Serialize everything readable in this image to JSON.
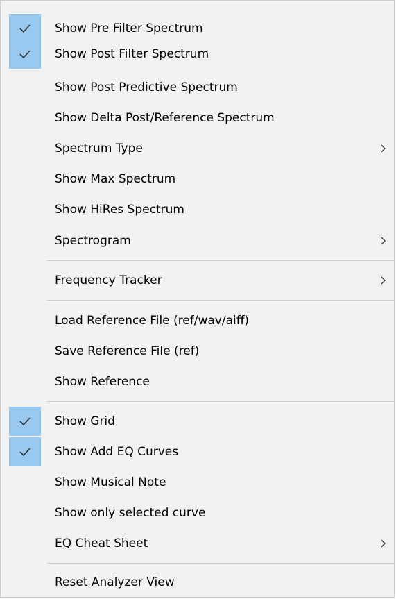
{
  "menu": {
    "items": [
      {
        "label": "Show Pre Filter Spectrum",
        "checked": true
      },
      {
        "label": "Show Post Filter Spectrum",
        "checked": true
      },
      {
        "label": "Show Post Predictive Spectrum",
        "checked": false
      },
      {
        "label": "Show Delta Post/Reference Spectrum",
        "checked": false
      },
      {
        "label": "Spectrum Type",
        "submenu": true
      },
      {
        "label": "Show Max Spectrum",
        "checked": false
      },
      {
        "label": "Show HiRes Spectrum",
        "checked": false
      },
      {
        "label": "Spectrogram",
        "submenu": true
      },
      {
        "label": "Frequency Tracker",
        "submenu": true
      },
      {
        "label": "Load Reference File (ref/wav/aiff)",
        "checked": false
      },
      {
        "label": "Save Reference File (ref)",
        "checked": false
      },
      {
        "label": "Show Reference",
        "checked": false
      },
      {
        "label": "Show Grid",
        "checked": true
      },
      {
        "label": "Show Add EQ Curves",
        "checked": true
      },
      {
        "label": "Show Musical Note",
        "checked": false
      },
      {
        "label": "Show only selected curve",
        "checked": false
      },
      {
        "label": "EQ Cheat Sheet",
        "submenu": true
      },
      {
        "label": "Reset Analyzer View",
        "checked": false
      }
    ]
  },
  "icons": {
    "check": "checkmark-icon",
    "submenu": "chevron-right-icon"
  },
  "colors": {
    "check_bg": "#99c9ef",
    "menu_bg": "#f2f2f2",
    "separator": "#cccccc"
  }
}
